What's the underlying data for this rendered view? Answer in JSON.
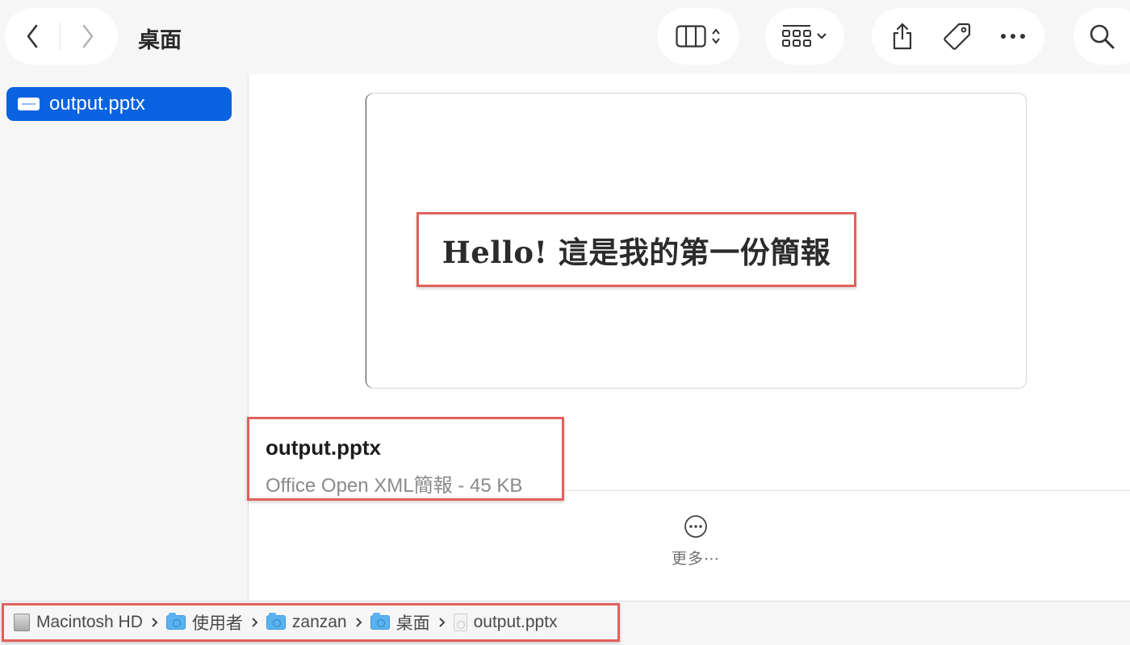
{
  "window": {
    "title": "桌面"
  },
  "sidebar": {
    "items": [
      {
        "label": "output.pptx",
        "selected": true
      }
    ]
  },
  "preview": {
    "slide_title": "Hello! 這是我的第一份簡報"
  },
  "file_info": {
    "name": "output.pptx",
    "kind_and_size": "Office Open XML簡報 - 45 KB"
  },
  "more": {
    "label": "更多⋯"
  },
  "path_bar": {
    "crumbs": [
      {
        "label": "Macintosh HD",
        "icon": "hard-drive-icon"
      },
      {
        "label": "使用者",
        "icon": "users-folder-icon"
      },
      {
        "label": "zanzan",
        "icon": "home-folder-icon"
      },
      {
        "label": "桌面",
        "icon": "desktop-folder-icon"
      },
      {
        "label": "output.pptx",
        "icon": "document-icon"
      }
    ]
  },
  "colors": {
    "selection": "#0a62e0",
    "highlight_border": "#e2605a"
  },
  "icons": [
    "back-chevron-icon",
    "forward-chevron-icon",
    "column-view-icon",
    "group-grid-icon",
    "share-icon",
    "tag-icon",
    "ellipsis-icon",
    "search-icon"
  ]
}
